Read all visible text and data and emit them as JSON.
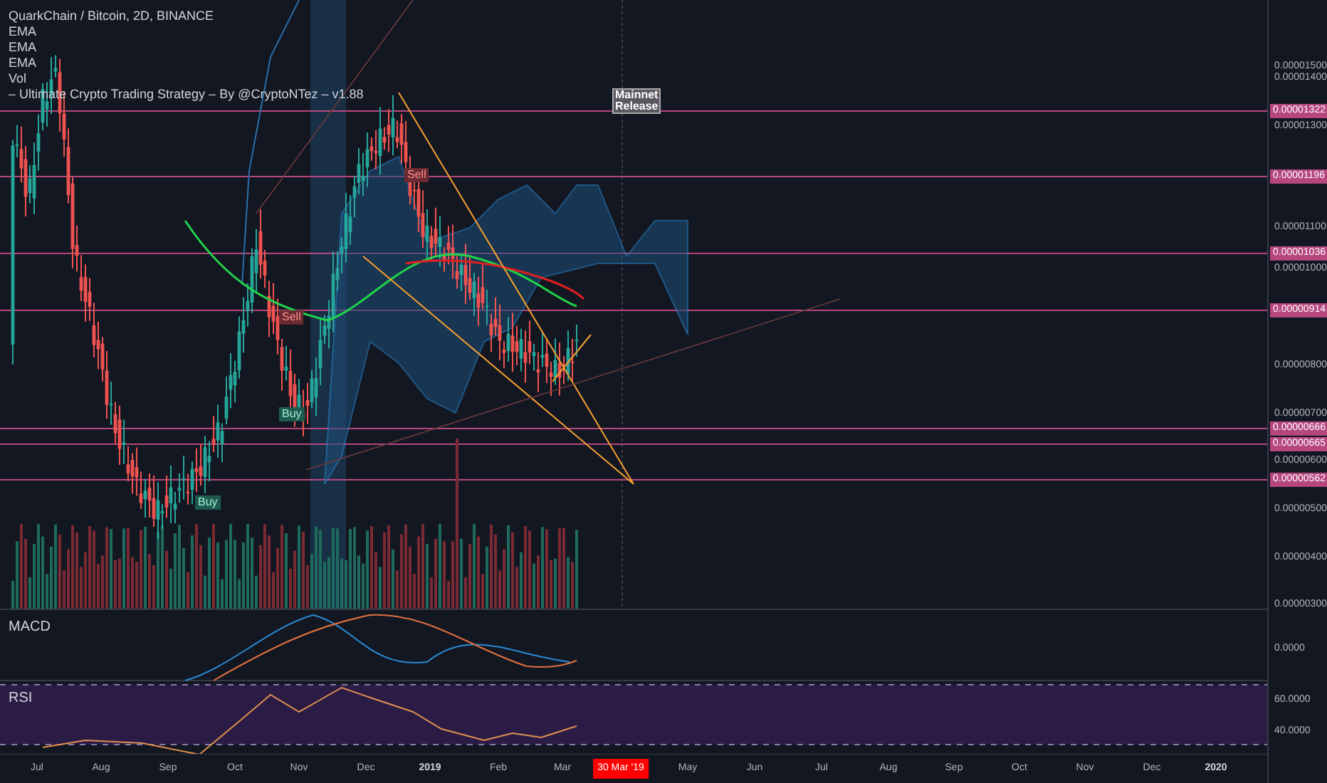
{
  "legend": {
    "title": "QuarkChain / Bitcoin, 2D, BINANCE",
    "studies": [
      "EMA",
      "EMA",
      "EMA",
      "Vol",
      "– Ultimate Crypto Trading Strategy – By @CryptoNTez – v1.88"
    ]
  },
  "annotation": {
    "text": "Mainnet\nRelease"
  },
  "signals": [
    {
      "kind": "sell",
      "label": "Sell"
    },
    {
      "kind": "sell",
      "label": "Sell"
    },
    {
      "kind": "buy",
      "label": "Buy"
    },
    {
      "kind": "buy",
      "label": "Buy"
    }
  ],
  "price_axis": {
    "ticks": [
      "0.00001500",
      "0.00001400",
      "0.00001300",
      "0.00001100",
      "0.00001000",
      "0.00000800",
      "0.00000700",
      "0.00000600",
      "0.00000500",
      "0.00000400",
      "0.00000300"
    ],
    "tags": [
      "0.00001322",
      "0.00001196",
      "0.00001036",
      "0.00000914",
      "0.00000666",
      "0.00000665",
      "0.00000562"
    ]
  },
  "macd": {
    "label": "MACD",
    "ticks": [
      "0.0000"
    ]
  },
  "rsi": {
    "label": "RSI",
    "ticks": [
      "60.0000",
      "40.0000"
    ]
  },
  "time_axis": {
    "labels": [
      {
        "text": "Jul",
        "kind": "month"
      },
      {
        "text": "Aug",
        "kind": "month"
      },
      {
        "text": "Sep",
        "kind": "month"
      },
      {
        "text": "Oct",
        "kind": "month"
      },
      {
        "text": "Nov",
        "kind": "month"
      },
      {
        "text": "Dec",
        "kind": "month"
      },
      {
        "text": "2019",
        "kind": "year"
      },
      {
        "text": "Feb",
        "kind": "month"
      },
      {
        "text": "Mar",
        "kind": "month"
      },
      {
        "text": "30 Mar '19",
        "kind": "cursor"
      },
      {
        "text": "May",
        "kind": "month"
      },
      {
        "text": "Jun",
        "kind": "month"
      },
      {
        "text": "Jul",
        "kind": "month"
      },
      {
        "text": "Aug",
        "kind": "month"
      },
      {
        "text": "Sep",
        "kind": "month"
      },
      {
        "text": "Oct",
        "kind": "month"
      },
      {
        "text": "Nov",
        "kind": "month"
      },
      {
        "text": "Dec",
        "kind": "month"
      },
      {
        "text": "2020",
        "kind": "year"
      }
    ]
  }
}
